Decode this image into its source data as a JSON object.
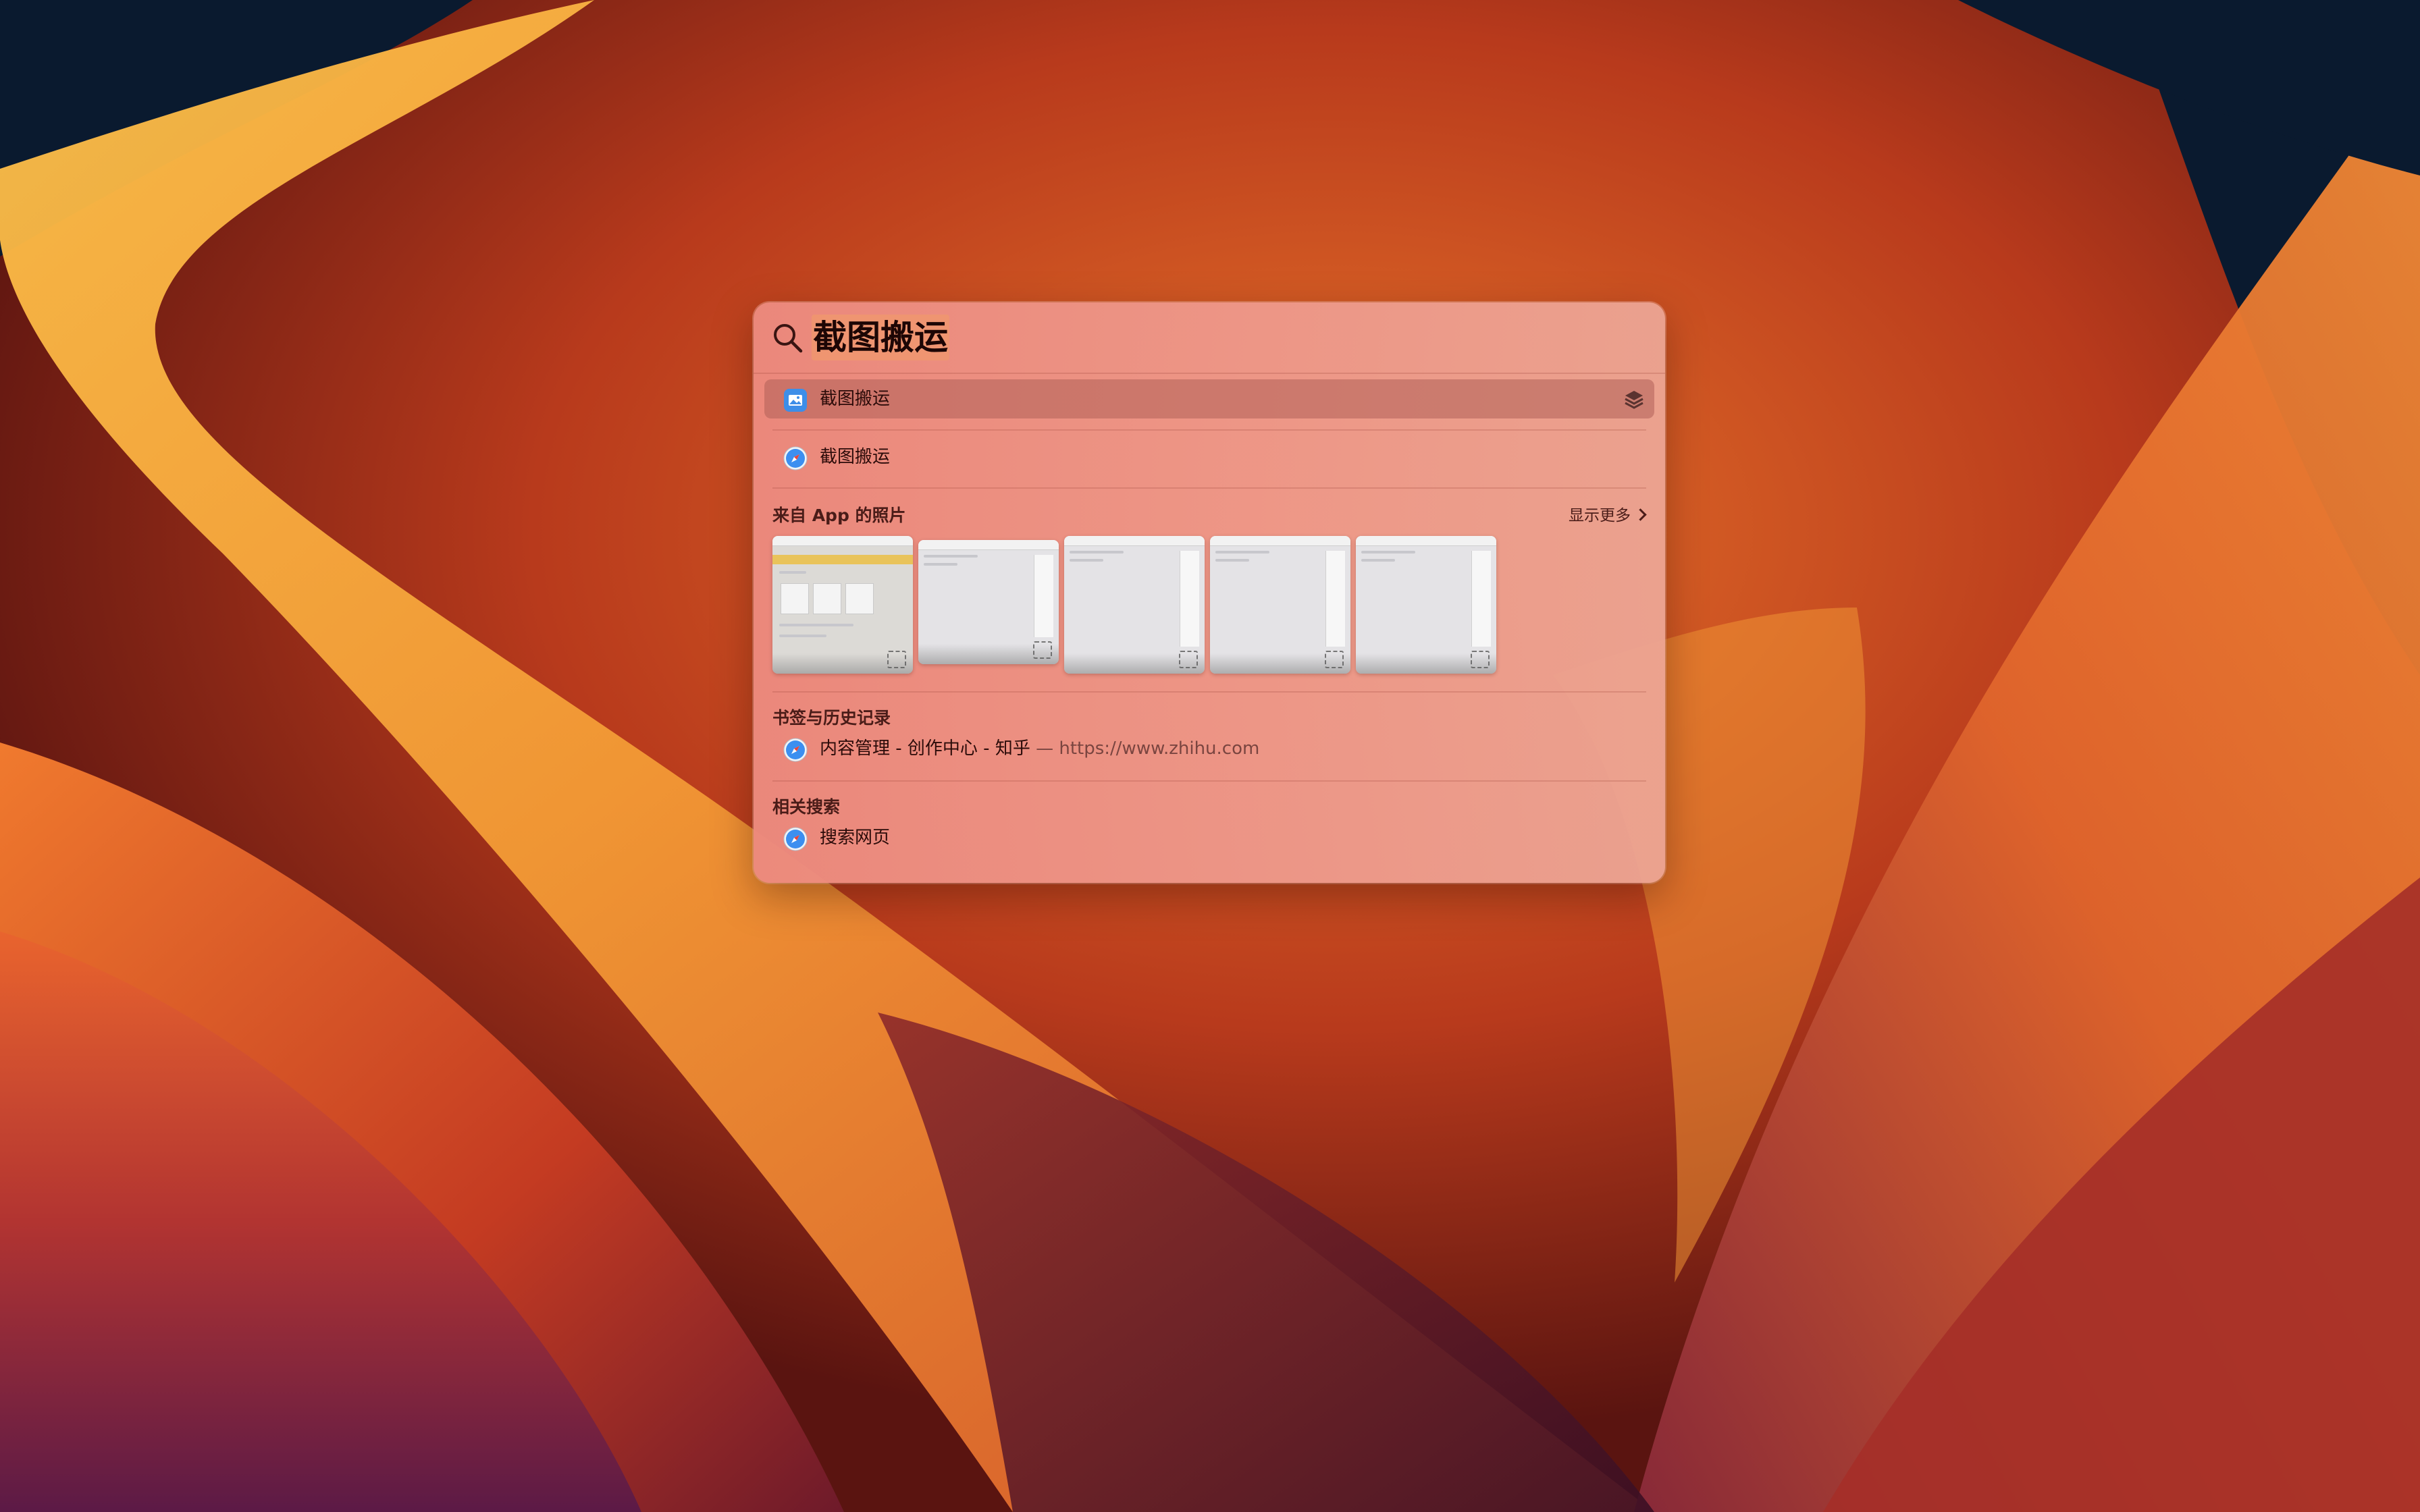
{
  "spotlight": {
    "query": "截图搬运",
    "top_results": [
      {
        "label": "截图搬运",
        "icon": "preview-app-icon",
        "selected": true,
        "trailing_icon": "stack-icon"
      },
      {
        "label": "截图搬运",
        "icon": "safari-icon",
        "selected": false
      }
    ],
    "photos_section": {
      "title": "来自 App 的照片",
      "show_more": "显示更多",
      "thumbnails": [
        "screenshot-thumbnail",
        "screenshot-thumbnail",
        "screenshot-thumbnail",
        "screenshot-thumbnail",
        "screenshot-thumbnail"
      ]
    },
    "bookmarks_section": {
      "title": "书签与历史记录",
      "items": [
        {
          "title": "内容管理 - 创作中心 - 知乎",
          "separator": " — ",
          "url": "https://www.zhihu.com",
          "icon": "safari-icon"
        }
      ]
    },
    "related_section": {
      "title": "相关搜索",
      "items": [
        {
          "label": "搜索网页",
          "icon": "safari-icon"
        }
      ]
    }
  },
  "colors": {
    "panel_tint": "#ec8a7e",
    "selection": "#b06058",
    "query_highlight": "#f0966e",
    "wallpaper_accent": "#e8702a"
  }
}
